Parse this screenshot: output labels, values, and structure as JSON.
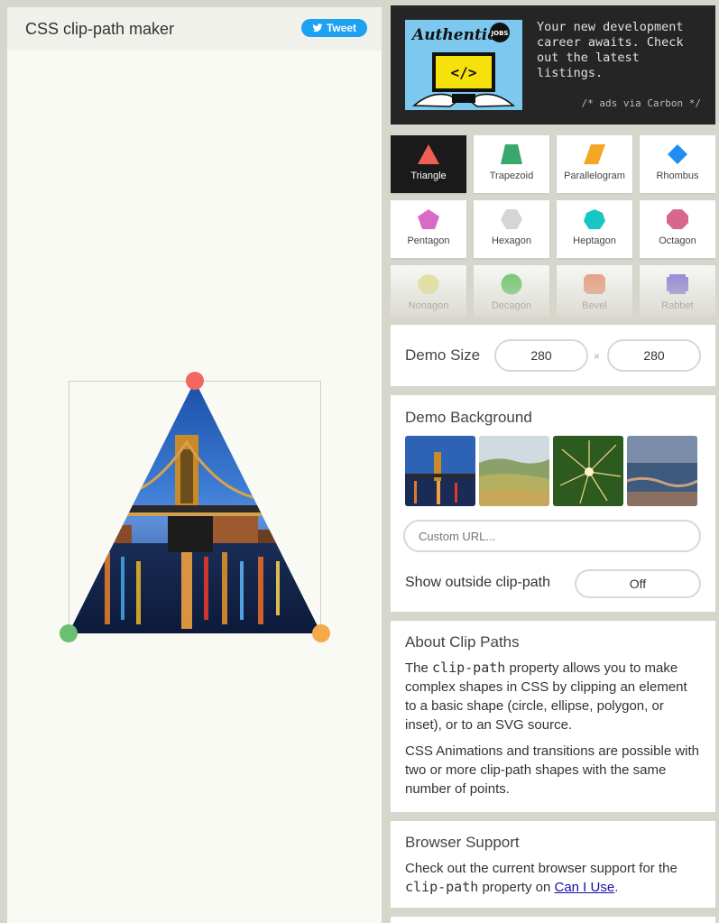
{
  "header": {
    "title": "CSS clip-path maker",
    "tweet_label": "Tweet"
  },
  "demo": {
    "shape": "Triangle",
    "handle_colors": [
      "#f2675e",
      "#6abf73",
      "#f5a94b"
    ]
  },
  "ad": {
    "brand": "Authentic",
    "badge": "JOBS",
    "code_glyph": "</>",
    "text": "Your new development career awaits. Check out the latest listings.",
    "credit": "/* ads via Carbon */"
  },
  "shapes": [
    {
      "label": "Triangle",
      "color": "#ef5f56",
      "icon": "triangle-icon",
      "active": true
    },
    {
      "label": "Trapezoid",
      "color": "#3aa76d",
      "icon": "trapezoid-icon"
    },
    {
      "label": "Parallelogram",
      "color": "#f5a623",
      "icon": "parallelogram-icon"
    },
    {
      "label": "Rhombus",
      "color": "#1f8ef1",
      "icon": "rhombus-icon"
    },
    {
      "label": "Pentagon",
      "color": "#d96bc6",
      "icon": "pentagon-icon"
    },
    {
      "label": "Hexagon",
      "color": "#d5d5d5",
      "icon": "hexagon-icon"
    },
    {
      "label": "Heptagon",
      "color": "#18c6c6",
      "icon": "heptagon-icon"
    },
    {
      "label": "Octagon",
      "color": "#d9668c",
      "icon": "octagon-icon"
    },
    {
      "label": "Nonagon",
      "color": "#ede58a",
      "icon": "nonagon-icon"
    },
    {
      "label": "Decagon",
      "color": "#4cc24c",
      "icon": "decagon-icon"
    },
    {
      "label": "Bevel",
      "color": "#f08a64",
      "icon": "bevel-icon"
    },
    {
      "label": "Rabbet",
      "color": "#7b6ad8",
      "icon": "rabbet-icon"
    }
  ],
  "demo_size": {
    "label": "Demo Size",
    "width": "280",
    "height": "280",
    "separator": "×"
  },
  "background": {
    "label": "Demo Background",
    "thumbs": [
      "bridge-photo",
      "hills-photo",
      "sparkler-photo",
      "ocean-photo"
    ],
    "url_placeholder": "Custom URL...",
    "outside_label": "Show outside clip-path",
    "outside_toggle": "Off"
  },
  "about": {
    "title": "About Clip Paths",
    "p1_before": "The ",
    "p1_code": "clip-path",
    "p1_after": " property allows you to make complex shapes in CSS by clipping an element to a basic shape (circle, ellipse, polygon, or inset), or to an SVG source.",
    "p2": "CSS Animations and transitions are possible with two or more clip-path shapes with the same number of points."
  },
  "support": {
    "title": "Browser Support",
    "text_before": "Check out the current browser support for the ",
    "code": "clip-path",
    "text_mid": " property on ",
    "link": "Can I Use",
    "text_after": "."
  }
}
